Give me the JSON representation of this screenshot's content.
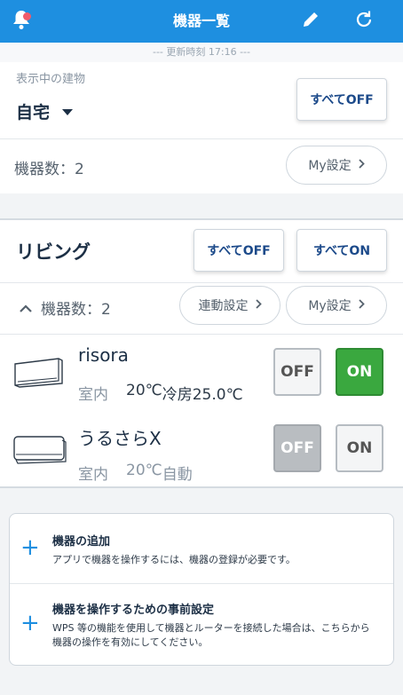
{
  "header": {
    "title": "機器一覧",
    "bell_icon": "bell-icon",
    "edit_icon": "pencil-icon",
    "refresh_icon": "refresh-icon",
    "bg_color": "#1e8fe0",
    "badge_color": "#f05b6a"
  },
  "updated_text": "--- 更新時刻 17:16 ---",
  "building": {
    "label": "表示中の建物",
    "selected": "自宅",
    "all_off_label": "すべてOFF",
    "device_count_label": "機器数：2",
    "my_settings_label": "My設定"
  },
  "room": {
    "name": "リビング",
    "all_off_label": "すべてOFF",
    "all_on_label": "すべてON",
    "device_count_label": "機器数：2",
    "link_settings_label": "連動設定",
    "my_settings_label": "My設定",
    "devices": [
      {
        "name": "risora",
        "status_prefix": "室内",
        "status_temp": "20℃",
        "status_mode": "冷房25.0℃",
        "off_label": "OFF",
        "on_label": "ON",
        "state": "on"
      },
      {
        "name": "うるさらX",
        "status_prefix": "室内",
        "status_temp": "20℃",
        "status_mode": "自動",
        "off_label": "OFF",
        "on_label": "ON",
        "state": "off"
      }
    ]
  },
  "info": {
    "add_title": "機器の追加",
    "add_desc": "アプリで機器を操作するには、機器の登録が必要です。",
    "setup_title": "機器を操作するための事前設定",
    "setup_desc": "WPS 等の機能を使用して機器とルーターを接続した場合は、こちらから機器の操作を有効にしてください。"
  },
  "colors": {
    "on_active": "#3aa83f",
    "off_active": "#b9bdc1",
    "accent": "#1e8fe0"
  }
}
